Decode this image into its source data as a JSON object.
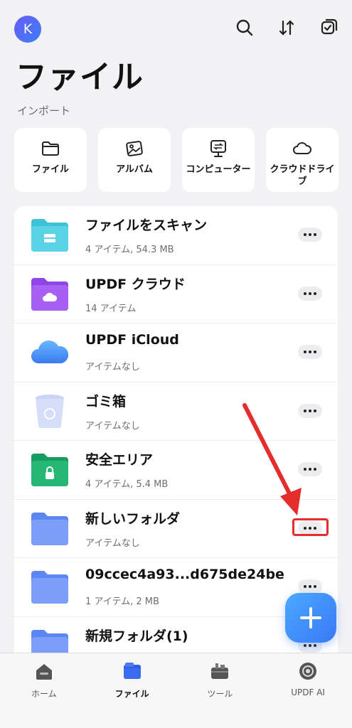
{
  "header": {
    "avatar_initial": "K",
    "icons": [
      "search-icon",
      "sort-icon",
      "select-icon"
    ]
  },
  "page_title": "ファイル",
  "import_section": {
    "label": "インポート",
    "items": [
      {
        "label": "ファイル",
        "icon": "folder-outline-icon"
      },
      {
        "label": "アルバム",
        "icon": "photos-icon"
      },
      {
        "label": "コンピューター",
        "icon": "computer-transfer-icon"
      },
      {
        "label": "クラウドドライブ",
        "icon": "cloud-icon"
      }
    ]
  },
  "files": [
    {
      "name": "ファイルをスキャン",
      "meta": "4 アイテム, 54.3 MB",
      "icon": "scan-folder-icon",
      "color": "#3cc3d8"
    },
    {
      "name": "UPDF クラウド",
      "meta": "14 アイテム",
      "icon": "cloud-folder-icon",
      "color": "#a25bf0"
    },
    {
      "name": "UPDF iCloud",
      "meta": "アイテムなし",
      "icon": "icloud-icon",
      "color": "#4a8ff5"
    },
    {
      "name": "ゴミ箱",
      "meta": "アイテムなし",
      "icon": "trash-icon",
      "color": "#b8c4f5"
    },
    {
      "name": "安全エリア",
      "meta": "4 アイテム, 5.4 MB",
      "icon": "secure-folder-icon",
      "color": "#22b873"
    },
    {
      "name": "新しいフォルダ",
      "meta": "アイテムなし",
      "icon": "folder-icon",
      "color": "#6e93f7"
    },
    {
      "name": "09ccec4a93...d675de24be",
      "meta": "1 アイテム, 2 MB",
      "icon": "folder-icon",
      "color": "#6e93f7"
    },
    {
      "name": "新規フォルダ(1)",
      "meta": "",
      "icon": "folder-icon",
      "color": "#6e93f7"
    }
  ],
  "fab": {
    "icon": "plus-icon"
  },
  "bottom_nav": [
    {
      "label": "ホーム",
      "icon": "home-icon",
      "active": false
    },
    {
      "label": "ファイル",
      "icon": "files-icon",
      "active": true
    },
    {
      "label": "ツール",
      "icon": "toolbox-icon",
      "active": false
    },
    {
      "label": "UPDF AI",
      "icon": "ai-icon",
      "active": false
    }
  ],
  "colors": {
    "accent": "#3a78f7",
    "annotation": "#e52d2d"
  }
}
